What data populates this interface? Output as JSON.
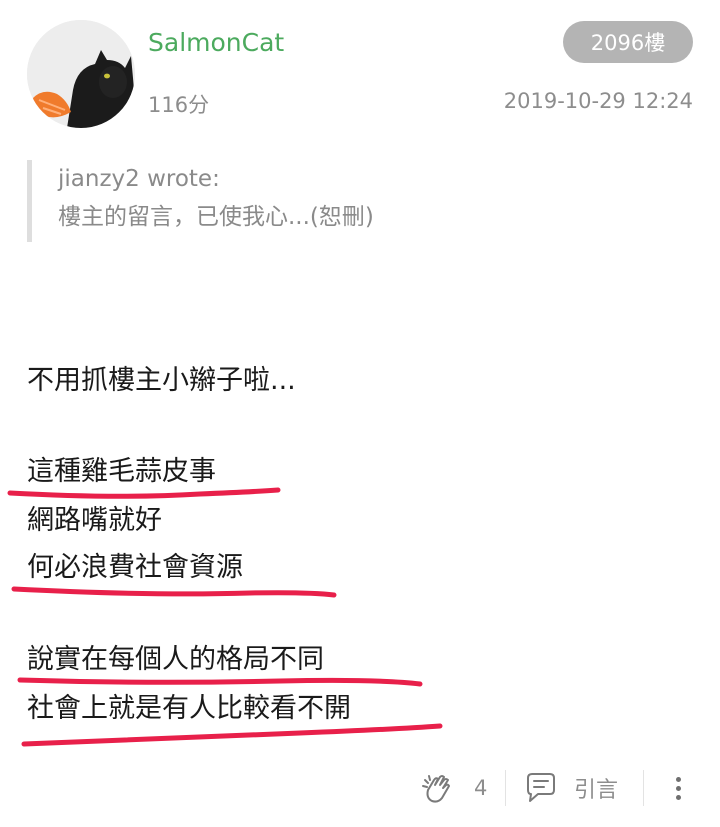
{
  "post": {
    "username": "SalmonCat",
    "score": "116分",
    "floor": "2096樓",
    "timestamp": "2019-10-29 12:24"
  },
  "quote": {
    "author": "jianzy2 wrote:",
    "text": "樓主的留言，已使我心...(恕刪)"
  },
  "body": {
    "lines": [
      "不用抓樓主小辮子啦...",
      "這種雞毛蒜皮事",
      "網路嘴就好",
      "何必浪費社會資源",
      "說實在每個人的格局不同",
      "社會上就是有人比較看不開"
    ]
  },
  "actions": {
    "like_count": "4",
    "quote_label": "引言"
  },
  "colors": {
    "username": "#4caa5e",
    "badge": "#b4b4b4",
    "underline": "#e8204a",
    "meta_text": "#8d8d8d"
  },
  "icons": [
    "clap-icon",
    "quote-bubble-icon",
    "more-vertical-icon",
    "avatar-cat-image"
  ]
}
